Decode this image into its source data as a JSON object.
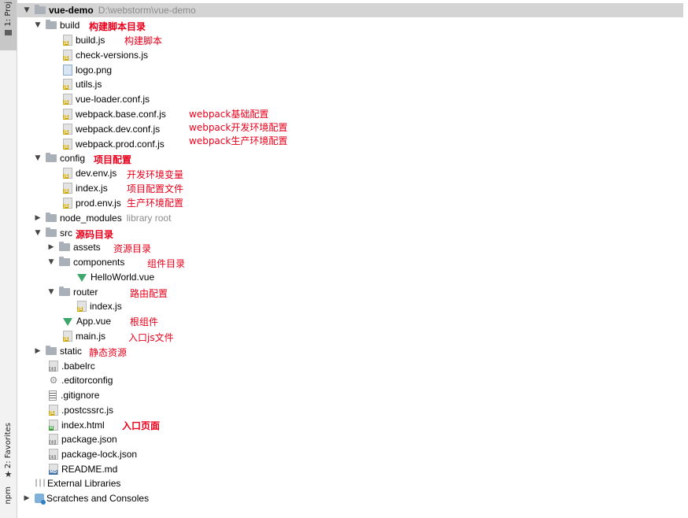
{
  "side_tabs": {
    "project": "1: Proj",
    "favorites": "2: Favorites",
    "npm": "npm"
  },
  "tree": {
    "root": {
      "name": "vue-demo",
      "path": "D:\\webstorm\\vue-demo"
    },
    "build": {
      "label": "build",
      "files": [
        "build.js",
        "check-versions.js",
        "logo.png",
        "utils.js",
        "vue-loader.conf.js",
        "webpack.base.conf.js",
        "webpack.dev.conf.js",
        "webpack.prod.conf.js"
      ]
    },
    "config": {
      "label": "config",
      "files": [
        "dev.env.js",
        "index.js",
        "prod.env.js"
      ]
    },
    "node_modules": {
      "label": "node_modules",
      "note": "library root"
    },
    "src": {
      "label": "src",
      "assets": "assets",
      "components": "components",
      "hello_world": "HelloWorld.vue",
      "router": "router",
      "router_index": "index.js",
      "app_vue": "App.vue",
      "main_js": "main.js"
    },
    "static": "static",
    "root_files": [
      ".babelrc",
      ".editorconfig",
      ".gitignore",
      ".postcssrc.js",
      "index.html",
      "package.json",
      "package-lock.json",
      "README.md"
    ],
    "external_libraries": "External Libraries",
    "scratches": "Scratches and Consoles"
  },
  "annotations": {
    "build": "构建脚本目录",
    "build_js": "构建脚本",
    "webpack_base": "webpack基础配置",
    "webpack_dev": "webpack开发环境配置",
    "webpack_prod": "webpack生产环境配置",
    "config": "项目配置",
    "dev_env": "开发环境变量",
    "index_js": "项目配置文件",
    "prod_env": "生产环境配置",
    "src": "源码目录",
    "assets": "资源目录",
    "components": "组件目录",
    "router": "路由配置",
    "app_vue": "根组件",
    "main_js": "入口js文件",
    "static": "静态资源",
    "index_html": "入口页面"
  }
}
